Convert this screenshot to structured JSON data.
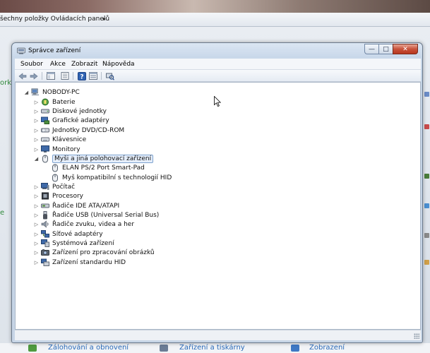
{
  "background": {
    "breadcrumb": "šechny položky Ovládacích panelů",
    "breadcrumb_arrow": "▸",
    "left_fragment_1": "ork",
    "left_fragment_2": "e",
    "bottom_links": [
      {
        "label": "Zálohování a obnovení",
        "icon": "backup-icon"
      },
      {
        "label": "Zařízení a tiskárny",
        "icon": "printer-icon"
      },
      {
        "label": "Zobrazení",
        "icon": "display-icon"
      }
    ]
  },
  "window": {
    "title": "Správce zařízení",
    "title_icon": "device-manager-icon",
    "caption": {
      "minimize": "—",
      "maximize": "□",
      "close": "✕"
    }
  },
  "menu": [
    "Soubor",
    "Akce",
    "Zobrazit",
    "Nápověda"
  ],
  "toolbar": [
    {
      "name": "back-icon"
    },
    {
      "name": "forward-icon"
    },
    {
      "name": "show-hide-tree-icon"
    },
    {
      "name": "properties-icon"
    },
    {
      "name": "help-icon"
    },
    {
      "name": "view-icon"
    },
    {
      "name": "scan-hardware-icon"
    }
  ],
  "tree": {
    "root": {
      "label": "NOBODY-PC",
      "icon": "computer-icon",
      "expanded": true
    },
    "items": [
      {
        "label": "Baterie",
        "icon": "battery-icon",
        "expanded": false
      },
      {
        "label": "Diskové jednotky",
        "icon": "disk-drive-icon",
        "expanded": false
      },
      {
        "label": "Grafické adaptéry",
        "icon": "display-adapter-icon",
        "expanded": false
      },
      {
        "label": "Jednotky DVD/CD-ROM",
        "icon": "dvd-drive-icon",
        "expanded": false
      },
      {
        "label": "Klávesnice",
        "icon": "keyboard-icon",
        "expanded": false
      },
      {
        "label": "Monitory",
        "icon": "monitor-icon",
        "expanded": false
      },
      {
        "label": "Myši a jiná polohovací zařízení",
        "icon": "mouse-icon",
        "expanded": true,
        "selected": true,
        "children": [
          {
            "label": "ELAN PS/2 Port Smart-Pad",
            "icon": "mouse-icon"
          },
          {
            "label": "Myš kompatibilní s technologií HID",
            "icon": "mouse-icon"
          }
        ]
      },
      {
        "label": "Počítač",
        "icon": "computer-icon",
        "expanded": false
      },
      {
        "label": "Procesory",
        "icon": "processor-icon",
        "expanded": false
      },
      {
        "label": "Řadiče IDE ATA/ATAPI",
        "icon": "ide-controller-icon",
        "expanded": false
      },
      {
        "label": "Řadiče USB (Universal Serial Bus)",
        "icon": "usb-icon",
        "expanded": false
      },
      {
        "label": "Řadiče zvuku, videa a her",
        "icon": "sound-icon",
        "expanded": false
      },
      {
        "label": "Síťové adaptéry",
        "icon": "network-icon",
        "expanded": false
      },
      {
        "label": "Systémová zařízení",
        "icon": "system-device-icon",
        "expanded": false
      },
      {
        "label": "Zařízení pro zpracování obrázků",
        "icon": "imaging-icon",
        "expanded": false
      },
      {
        "label": "Zařízení standardu HID",
        "icon": "hid-icon",
        "expanded": false
      }
    ]
  },
  "colors": {
    "link_green": "#2f8a3a",
    "link_blue": "#2a6ab8",
    "selection_border": "#7da2ce",
    "selection_fill": "#e5eefb",
    "close_red": "#c8523b"
  }
}
